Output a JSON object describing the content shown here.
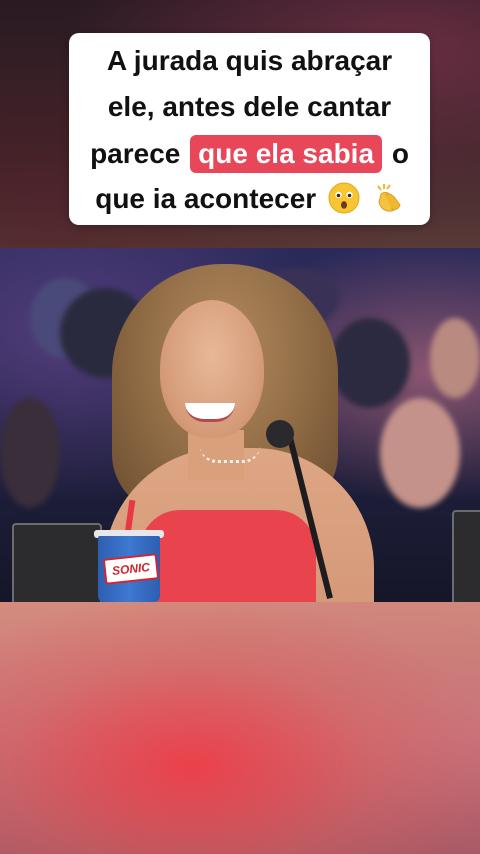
{
  "caption": {
    "line1": "A jurada quis abraçar",
    "line2": "ele, antes dele cantar",
    "line3_before": "parece",
    "line3_highlight": "que ela sabia",
    "line3_after": "o",
    "line4": "que ia acontecer",
    "emoji_1": "astonished-face-emoji",
    "emoji_2": "clapping-hands-emoji",
    "highlight_color": "#e8475a"
  },
  "video": {
    "cup_brand": "SONIC",
    "dress_color": "#e9434e"
  }
}
